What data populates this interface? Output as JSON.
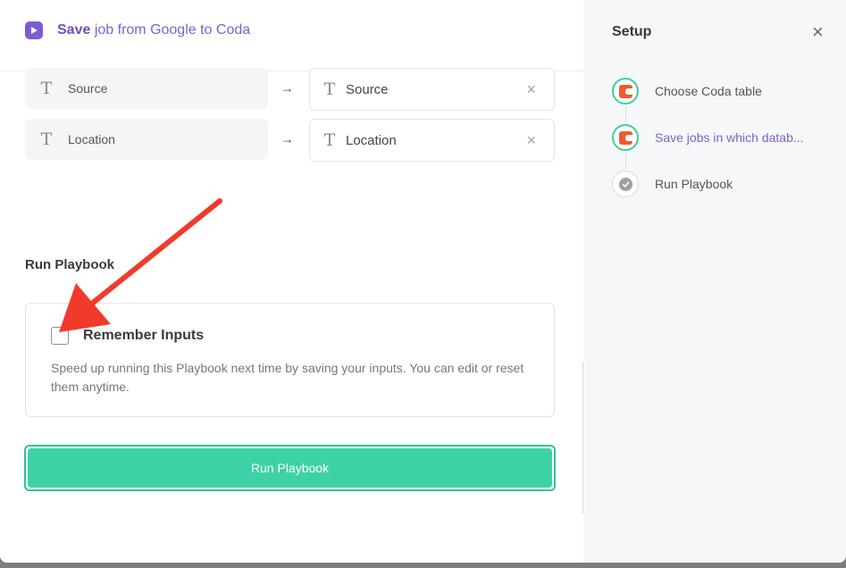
{
  "header": {
    "title_strong": "Save",
    "title_rest": " job from Google to Coda"
  },
  "mappings": [
    {
      "source": "Source",
      "target": "Source",
      "type_glyph": "T",
      "arrow": "→",
      "clear": "×"
    },
    {
      "source": "Location",
      "target": "Location",
      "type_glyph": "T",
      "arrow": "→",
      "clear": "×"
    }
  ],
  "run_section": {
    "title": "Run Playbook",
    "remember_label": "Remember Inputs",
    "remember_checked": false,
    "remember_description": "Speed up running this Playbook next time by saving your inputs. You can edit or reset them anytime.",
    "run_button": "Run Playbook"
  },
  "sidebar": {
    "title": "Setup",
    "close": "×",
    "steps": [
      {
        "label": "Choose Coda table",
        "status": "done",
        "icon": "coda-icon"
      },
      {
        "label": "Save jobs in which datab...",
        "status": "active",
        "icon": "coda-icon"
      },
      {
        "label": "Run Playbook",
        "status": "pending",
        "icon": "check-icon"
      }
    ]
  },
  "colors": {
    "accent": "#7b5cd6",
    "success": "#3dd1a6",
    "annotation": "#f03a2c",
    "coda": "#ef5a2e"
  }
}
